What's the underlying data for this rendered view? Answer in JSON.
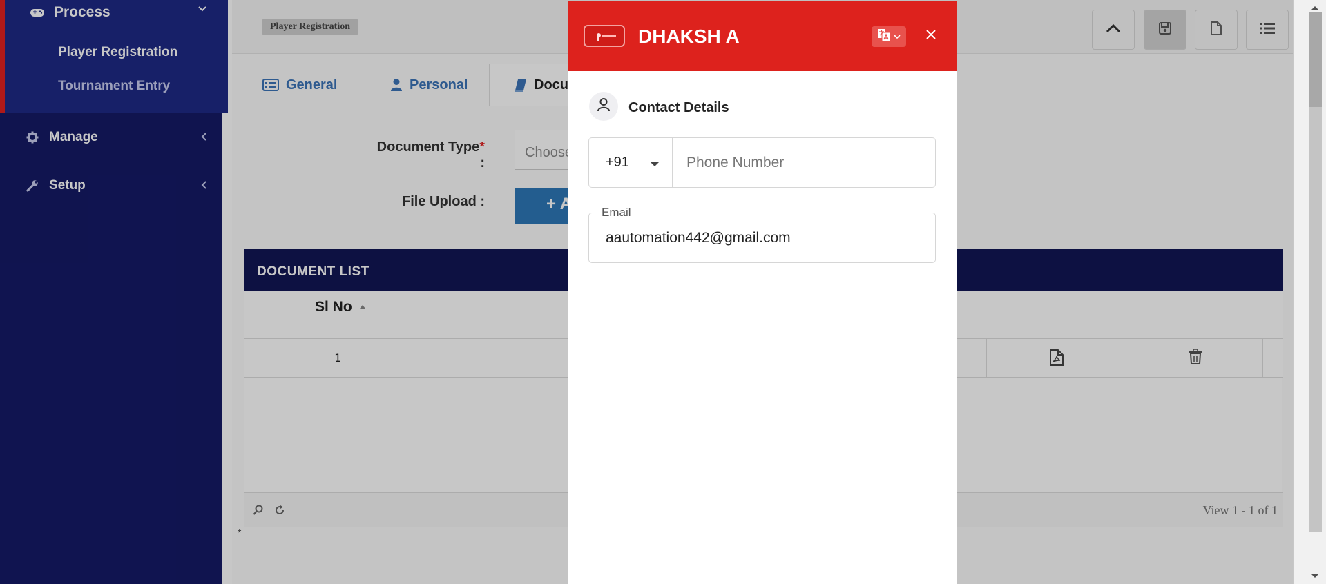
{
  "sidebar": {
    "process": {
      "label": "Process",
      "icon": "gamepad-icon"
    },
    "sub_items": [
      {
        "label": "Player Registration",
        "color": "#ffffff"
      },
      {
        "label": "Tournament Entry",
        "color": "#c9cdf0"
      }
    ],
    "manage": {
      "label": "Manage",
      "icon": "gear-icon"
    },
    "setup": {
      "label": "Setup",
      "icon": "wrench-icon"
    },
    "colors": {
      "bg": "#151a66",
      "active_block": "#1e2a86",
      "accent": "#e02020"
    }
  },
  "page": {
    "breadcrumb": "Player Registration",
    "tabs": [
      {
        "label": "General",
        "icon": "table-list-icon"
      },
      {
        "label": "Personal",
        "icon": "user-icon"
      },
      {
        "label": "Docu",
        "icon": "book-icon"
      }
    ],
    "form": {
      "document_type_label": "Document Type",
      "required_mark": "*",
      "label_suffix": " :",
      "document_type_placeholder": "Choose",
      "file_upload_label": "File Upload :",
      "add_button_label": "+ A"
    },
    "grid": {
      "title": "DOCUMENT LIST",
      "column_header": "Sl No",
      "rows": [
        {
          "sl_no": "1"
        }
      ],
      "footer_text": "View 1 - 1 of 1"
    },
    "footnote": "*"
  },
  "modal": {
    "title": "DHAKSH A",
    "section_title": "Contact Details",
    "country_code": "+91",
    "phone_placeholder": "Phone Number",
    "email_label": "Email",
    "email_value": "aautomation442@gmail.com",
    "header_color": "#dd221d"
  }
}
